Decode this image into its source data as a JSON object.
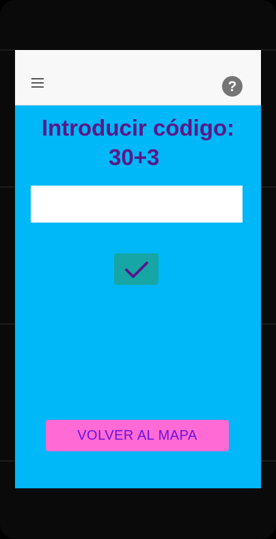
{
  "app": {
    "title_line1": "Introducir código:",
    "title_line2": "30+3",
    "code_input": {
      "value": "",
      "placeholder": ""
    },
    "confirm_icon": "check-icon",
    "back_button_label": "VOLVER AL MAPA"
  },
  "toolbar": {
    "menu_icon": "hamburger-menu-icon",
    "help_icon": "help-circle-icon"
  },
  "colors": {
    "background": "#00b7f7",
    "title": "#5a1888",
    "confirm_button": "#16a6a6",
    "back_button": "#ff6ad4",
    "back_button_text": "#6b12d8",
    "toolbar": "#f8f8f8"
  }
}
